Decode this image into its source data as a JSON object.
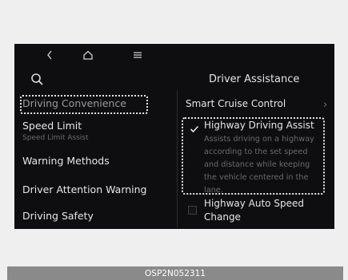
{
  "nav": {
    "back_icon": "chevron-left-icon",
    "home_icon": "home-icon",
    "menu_icon": "menu-icon",
    "search_icon": "search-icon"
  },
  "left_menu": {
    "items": [
      {
        "label": "Driving Convenience",
        "selected": true
      },
      {
        "label": "Speed Limit",
        "sub": "Speed Limit Assist"
      },
      {
        "label": "Warning Methods"
      },
      {
        "label": "Driver Attention Warning"
      },
      {
        "label": "Driving Safety"
      }
    ]
  },
  "panel": {
    "title": "Driver Assistance",
    "smart_cruise": "Smart Cruise Control",
    "hda": {
      "label": "Highway Driving Assist",
      "checked": true,
      "description": "Assists driving on a highway according to the set speed and distance while keeping the vehicle centered in the lane."
    },
    "auto_speed": {
      "line1": "Highway Auto Speed",
      "line2": "Change",
      "checked": false
    }
  },
  "caption": "OSP2N052311",
  "colors": {
    "screen_bg": "#0e0e10",
    "page_bg": "#efefef",
    "caption_bg": "#8a8a8a"
  }
}
